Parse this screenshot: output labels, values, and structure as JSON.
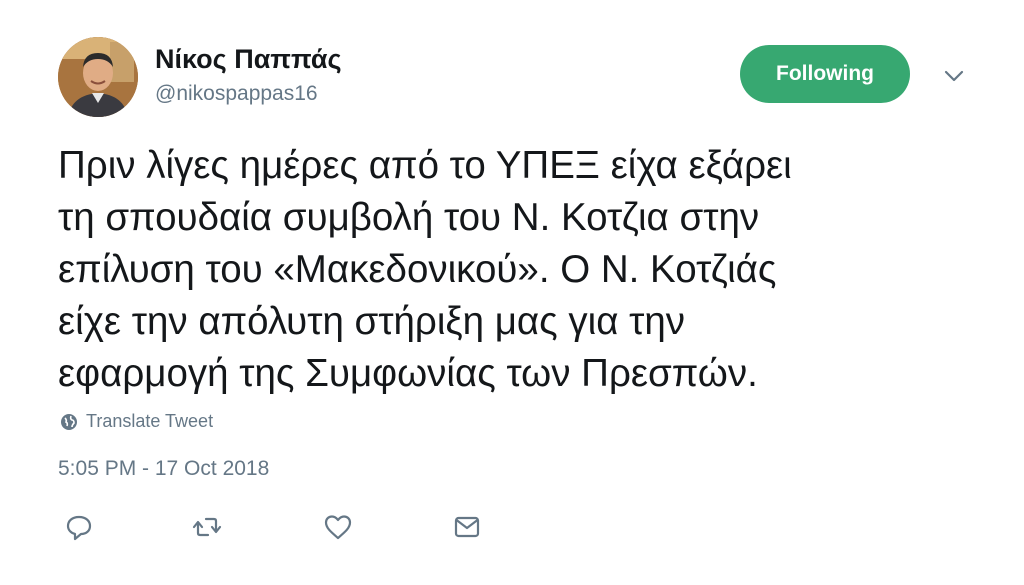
{
  "user": {
    "display_name": "Νίκος Παππάς",
    "handle": "@nikospappas16",
    "avatar_icon": "profile-photo"
  },
  "follow_button": {
    "label": "Following",
    "color": "#37a871"
  },
  "menu": {
    "icon": "chevron-down-icon"
  },
  "tweet": {
    "lines": [
      "Πριν λίγες ημέρες από το ΥΠΕΞ είχα εξάρει",
      "τη σπουδαία συμβολή του Ν. Κοτζια στην",
      "επίλυση του «Μακεδονικού». Ο Ν. Κοτζιάς",
      "είχε την απόλυτη στήριξη μας για την",
      "εφαρμογή της Συμφωνίας των Πρεσπών."
    ],
    "translate_label": "Translate Tweet",
    "timestamp": "5:05 PM - 17 Oct 2018"
  },
  "actions": {
    "reply_icon": "reply-icon",
    "retweet_icon": "retweet-icon",
    "like_icon": "heart-icon",
    "dm_icon": "envelope-icon"
  },
  "colors": {
    "text": "#14171a",
    "secondary": "#657786",
    "icon": "#657786"
  }
}
